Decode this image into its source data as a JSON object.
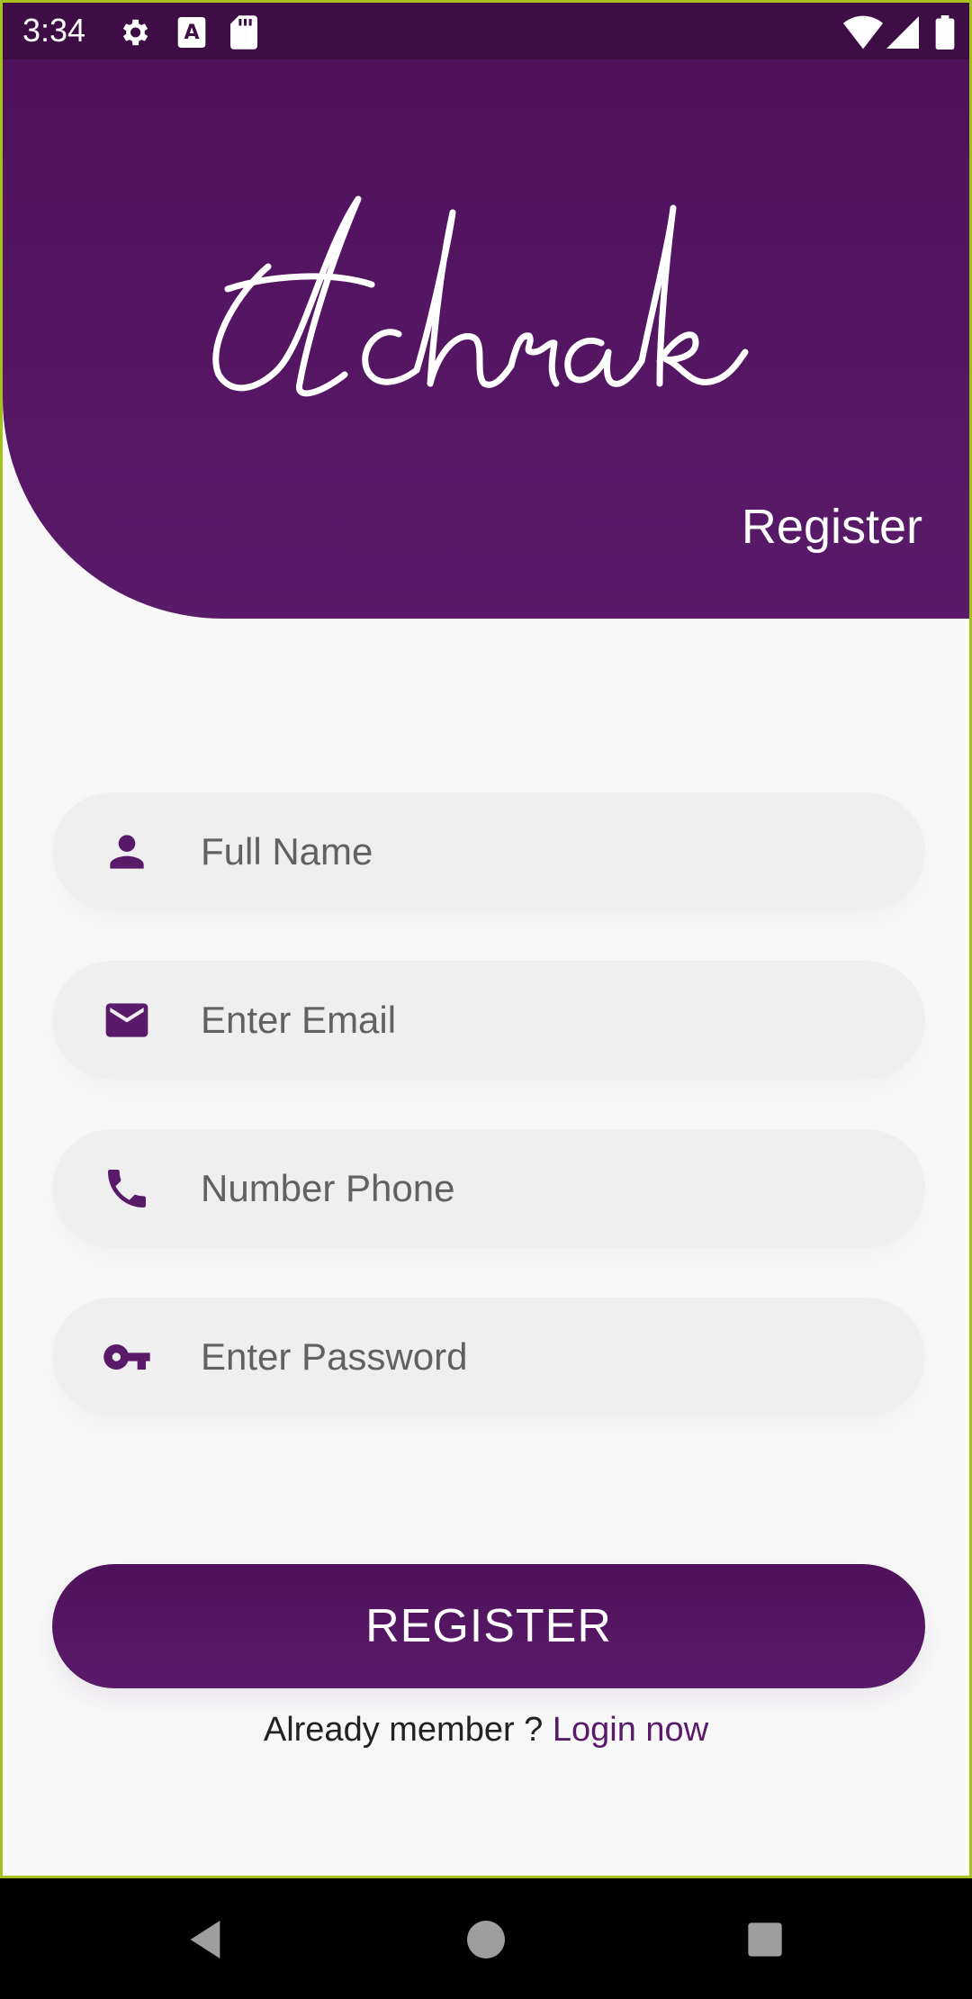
{
  "status_bar": {
    "time": "3:34",
    "icons": [
      "gear-icon",
      "a-notification-icon",
      "sd-card-icon",
      "wifi-icon",
      "cell-signal-icon",
      "battery-icon"
    ]
  },
  "header": {
    "logo_text": "Ichrak",
    "screen_title": "Register"
  },
  "form": {
    "full_name": {
      "placeholder": "Full Name",
      "value": "",
      "icon": "person-icon"
    },
    "email": {
      "placeholder": "Enter Email",
      "value": "",
      "icon": "mail-icon"
    },
    "phone": {
      "placeholder": "Number Phone",
      "value": "",
      "icon": "phone-icon"
    },
    "password": {
      "placeholder": "Enter Password",
      "value": "",
      "icon": "key-icon"
    },
    "submit_label": "REGISTER",
    "login_prompt": "Already member ?",
    "login_link": "Login now"
  },
  "nav_bar": {
    "icons": [
      "back-icon",
      "home-icon",
      "recents-icon"
    ]
  },
  "colors": {
    "brand_purple": "#591a69",
    "status_bar": "#3e0d45",
    "field_bg": "#efefef",
    "page_bg": "#f8f8f8"
  }
}
